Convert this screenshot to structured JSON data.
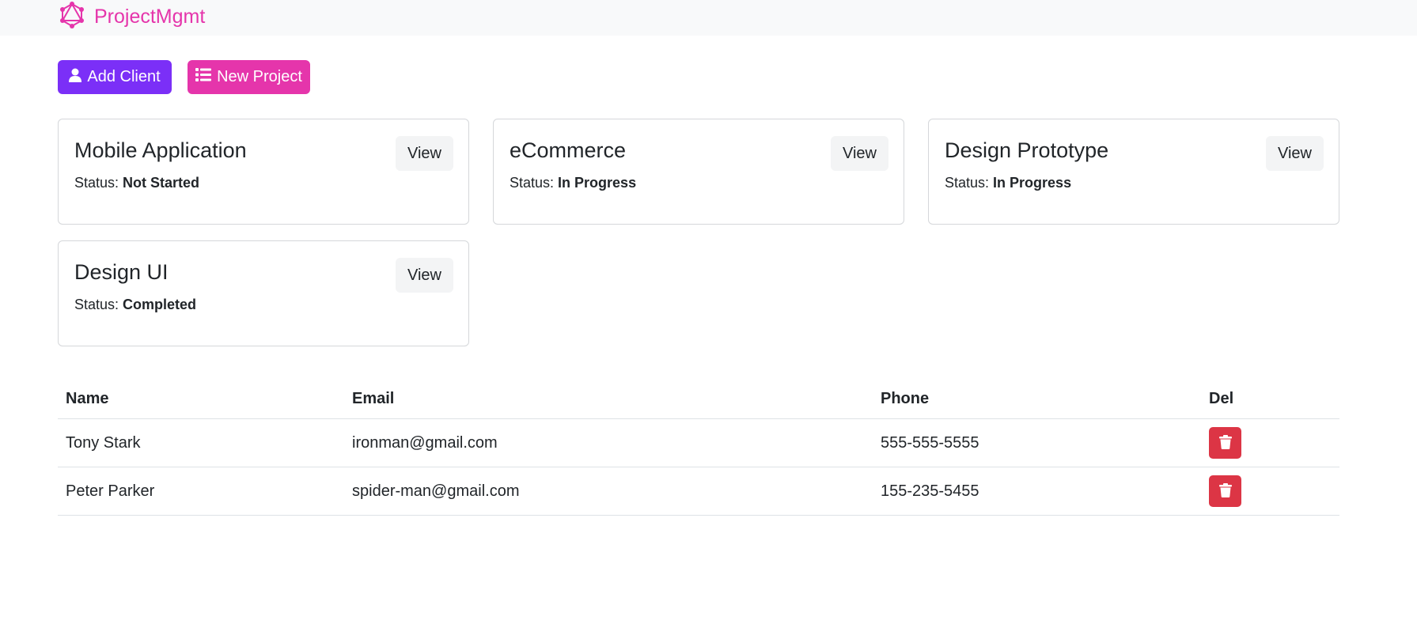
{
  "app": {
    "brand": "ProjectMgmt"
  },
  "colors": {
    "brand_pink": "#e535ab",
    "add_client": "#7b2ff7",
    "new_project": "#e535ab",
    "danger": "#dc3545"
  },
  "toolbar": {
    "add_client": {
      "label": "Add Client",
      "icon": "user-icon"
    },
    "new_project": {
      "label": "New Project",
      "icon": "list-icon"
    }
  },
  "projects": [
    {
      "name": "Mobile Application",
      "status_label": "Status:",
      "status": "Not Started",
      "view_label": "View"
    },
    {
      "name": "eCommerce",
      "status_label": "Status:",
      "status": "In Progress",
      "view_label": "View"
    },
    {
      "name": "Design Prototype",
      "status_label": "Status:",
      "status": "In Progress",
      "view_label": "View"
    },
    {
      "name": "Design UI",
      "status_label": "Status:",
      "status": "Completed",
      "view_label": "View"
    }
  ],
  "clients": {
    "headers": [
      "Name",
      "Email",
      "Phone",
      "Del"
    ],
    "rows": [
      {
        "name": "Tony Stark",
        "email": "ironman@gmail.com",
        "phone": "555-555-5555",
        "delete_icon": "trash-icon"
      },
      {
        "name": "Peter Parker",
        "email": "spider-man@gmail.com",
        "phone": "155-235-5455",
        "delete_icon": "trash-icon"
      }
    ]
  }
}
